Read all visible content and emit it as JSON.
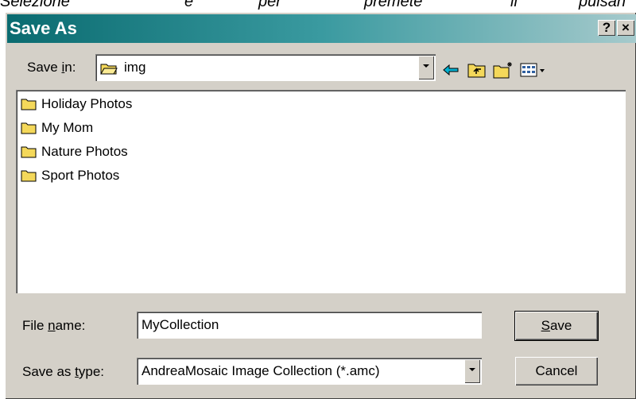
{
  "background_text": [
    "Selezione",
    "e",
    "per",
    "premete",
    "il",
    "pulsan"
  ],
  "dialog": {
    "title": "Save As",
    "help_btn": "?",
    "close_btn": "×"
  },
  "save_in": {
    "label_pre": "Save ",
    "label_u": "i",
    "label_post": "n:",
    "value": "img"
  },
  "toolbar": {
    "back_icon": "back-arrow-icon",
    "up_icon": "up-folder-icon",
    "newfolder_icon": "new-folder-icon",
    "views_icon": "views-menu-icon"
  },
  "files": [
    {
      "name": "Holiday Photos"
    },
    {
      "name": "My Mom"
    },
    {
      "name": "Nature Photos"
    },
    {
      "name": "Sport Photos"
    }
  ],
  "file_name": {
    "label_pre": "File ",
    "label_u": "n",
    "label_post": "ame:",
    "value": "MyCollection"
  },
  "save_type": {
    "label_pre": "Save as ",
    "label_u": "t",
    "label_post": "ype:",
    "value": "AndreaMosaic Image Collection (*.amc)"
  },
  "buttons": {
    "save_u": "S",
    "save_rest": "ave",
    "cancel": "Cancel"
  },
  "colors": {
    "title_start": "#0a6b70",
    "title_end": "#a6cacc",
    "dialog_face": "#d4d0c8",
    "folder_yellow": "#f4d85a"
  }
}
